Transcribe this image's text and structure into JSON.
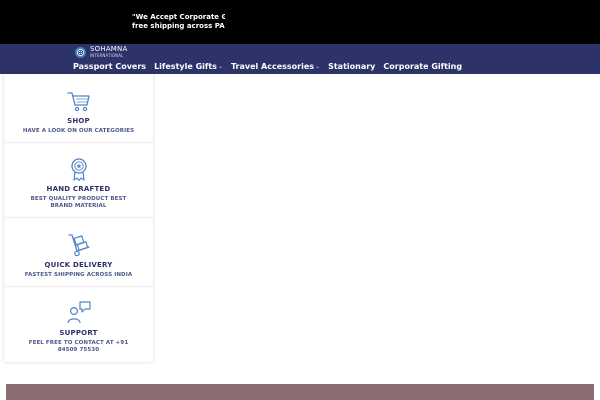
{
  "announcement": {
    "line1": "\"We Accept Corporate Gifti",
    "line2": "free shipping across PAN Ir"
  },
  "brand": {
    "name": "SOHAMNA",
    "subtitle": "INTERNATIONAL"
  },
  "nav": {
    "items": [
      {
        "label": "Passport Covers",
        "has_dropdown": false
      },
      {
        "label": "Lifestyle Gifts",
        "has_dropdown": true
      },
      {
        "label": "Travel Accessories",
        "has_dropdown": true
      },
      {
        "label": "Stationary",
        "has_dropdown": false
      },
      {
        "label": "Corporate Gifting",
        "has_dropdown": false
      }
    ]
  },
  "features": [
    {
      "icon": "shopping-cart-icon",
      "title": "SHOP",
      "subtitle": "HAVE A LOOK ON OUR CATEGORIES"
    },
    {
      "icon": "award-badge-icon",
      "title": "HAND CRAFTED",
      "subtitle": "BEST QUALITY PRODUCT BEST BRAND MATERIAL"
    },
    {
      "icon": "hand-truck-icon",
      "title": "QUICK DELIVERY",
      "subtitle": "FASTEST SHIPPING ACROSS INDIA"
    },
    {
      "icon": "support-chat-icon",
      "title": "SUPPORT",
      "subtitle": "FEEL FREE TO CONTACT AT +91 84509 75530"
    }
  ],
  "colors": {
    "announcement_bg": "#000000",
    "nav_bg": "#2d3268",
    "accent_blue": "#3f7fc7",
    "feature_title": "#2d3268",
    "feature_subtitle": "#4c5688",
    "banner_strip": "#8c6d73"
  }
}
